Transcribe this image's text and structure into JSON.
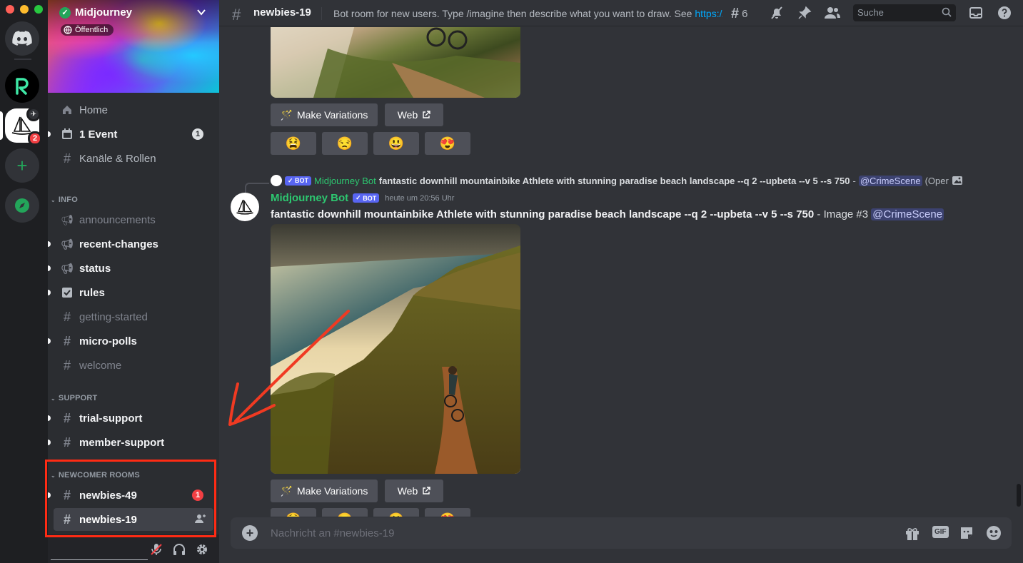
{
  "server": {
    "name": "Midjourney",
    "visibility": "Öffentlich",
    "rail_badge": "2"
  },
  "nav": {
    "home": "Home",
    "event": "1 Event",
    "event_count": "1",
    "channels_roles": "Kanäle & Rollen"
  },
  "categories": {
    "info": "INFO",
    "support": "SUPPORT",
    "newcomer": "NEWCOMER ROOMS"
  },
  "channels": {
    "announcements": "announcements",
    "recent_changes": "recent-changes",
    "status": "status",
    "rules": "rules",
    "getting_started": "getting-started",
    "micro_polls": "micro-polls",
    "welcome": "welcome",
    "trial_support": "trial-support",
    "member_support": "member-support",
    "newbies_49": "newbies-49",
    "newbies_49_badge": "1",
    "newbies_19": "newbies-19"
  },
  "topbar": {
    "channel": "newbies-19",
    "topic": "Bot room for new users. Type /imagine then describe what you want to draw. See ",
    "topic_link": "https://...",
    "threads_count": "6",
    "search_placeholder": "Suche"
  },
  "buttons": {
    "make_variations": "Make Variations",
    "web": "Web"
  },
  "reactions": [
    "😫",
    "😒",
    "😃",
    "😍"
  ],
  "reply": {
    "bot_tag": "BOT",
    "author": "Midjourney Bot",
    "text": "fantastic downhill mountainbike Athlete with stunning paradise beach landscape --q 2 --upbeta --v 5 --s 750",
    "separator": " - ",
    "mention": "@CrimeScene",
    "trail": "(Oper"
  },
  "message": {
    "author": "Midjourney Bot",
    "bot_tag": "BOT",
    "timestamp": "heute um 20:56 Uhr",
    "prompt": "fantastic downhill mountainbike Athlete with stunning paradise beach landscape --q 2 --upbeta --v 5 --s 750",
    "suffix": " - Image #3 ",
    "mention": "@CrimeScene"
  },
  "composer": {
    "placeholder": "Nachricht an #newbies-19",
    "gif": "GIF"
  },
  "colors": {
    "accent": "#5865f2",
    "bot_name": "#2dc770",
    "highlight_box": "#ff2b14",
    "annotation_arrow": "#f03a22"
  },
  "icons": [
    "discord-icon",
    "r-app-icon",
    "midjourney-server-icon",
    "add-server-icon",
    "explore-icon",
    "home-icon",
    "calendar-icon",
    "channels-icon",
    "megaphone-icon",
    "checkbox-icon",
    "hash-icon",
    "threads-icon",
    "mute-icon",
    "pin-icon",
    "members-icon",
    "search-icon",
    "inbox-icon",
    "help-icon",
    "gift-icon",
    "sticker-icon",
    "emoji-icon",
    "mic-muted-icon",
    "headphones-icon",
    "settings-icon"
  ]
}
